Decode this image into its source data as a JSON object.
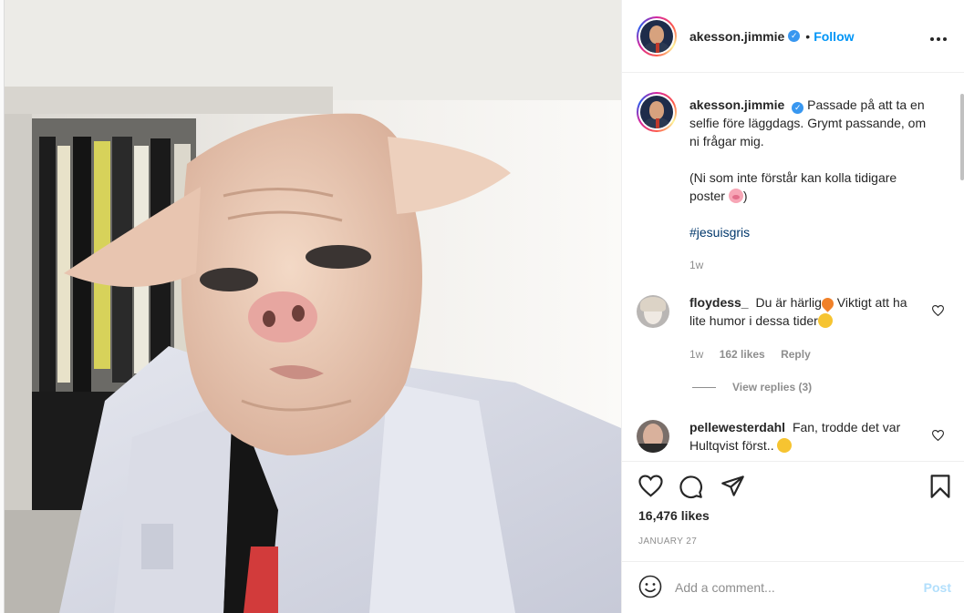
{
  "post": {
    "username": "akesson.jimmie",
    "verified": true,
    "follow_label": "Follow",
    "separator": "•",
    "more_icon": "more-horizontal-icon"
  },
  "caption": {
    "username": "akesson.jimmie",
    "line1": "Passade på att ta en selfie före läggdags. Grymt passande, om ni frågar mig.",
    "line2": "(Ni som inte förstår kan kolla tidigare poster",
    "line2_end": ")",
    "hashtag": "#jesuisgris",
    "time": "1w"
  },
  "comments": [
    {
      "username": "floydess_",
      "text_a": "Du är härlig",
      "text_b": " Viktigt att ha lite humor i dessa tider",
      "time": "1w",
      "likes": "162 likes",
      "reply": "Reply",
      "view_replies": "View replies (3)"
    },
    {
      "username": "pellewesterdahl",
      "text": "Fan, trodde det var Hultqvist först.."
    }
  ],
  "actions": {
    "likes": "16,476 likes",
    "date": "JANUARY 27"
  },
  "add_comment": {
    "placeholder": "Add a comment...",
    "post_label": "Post"
  },
  "colors": {
    "link_blue": "#0095f6",
    "post_disabled": "#b2dffc",
    "hashtag": "#00376b"
  }
}
